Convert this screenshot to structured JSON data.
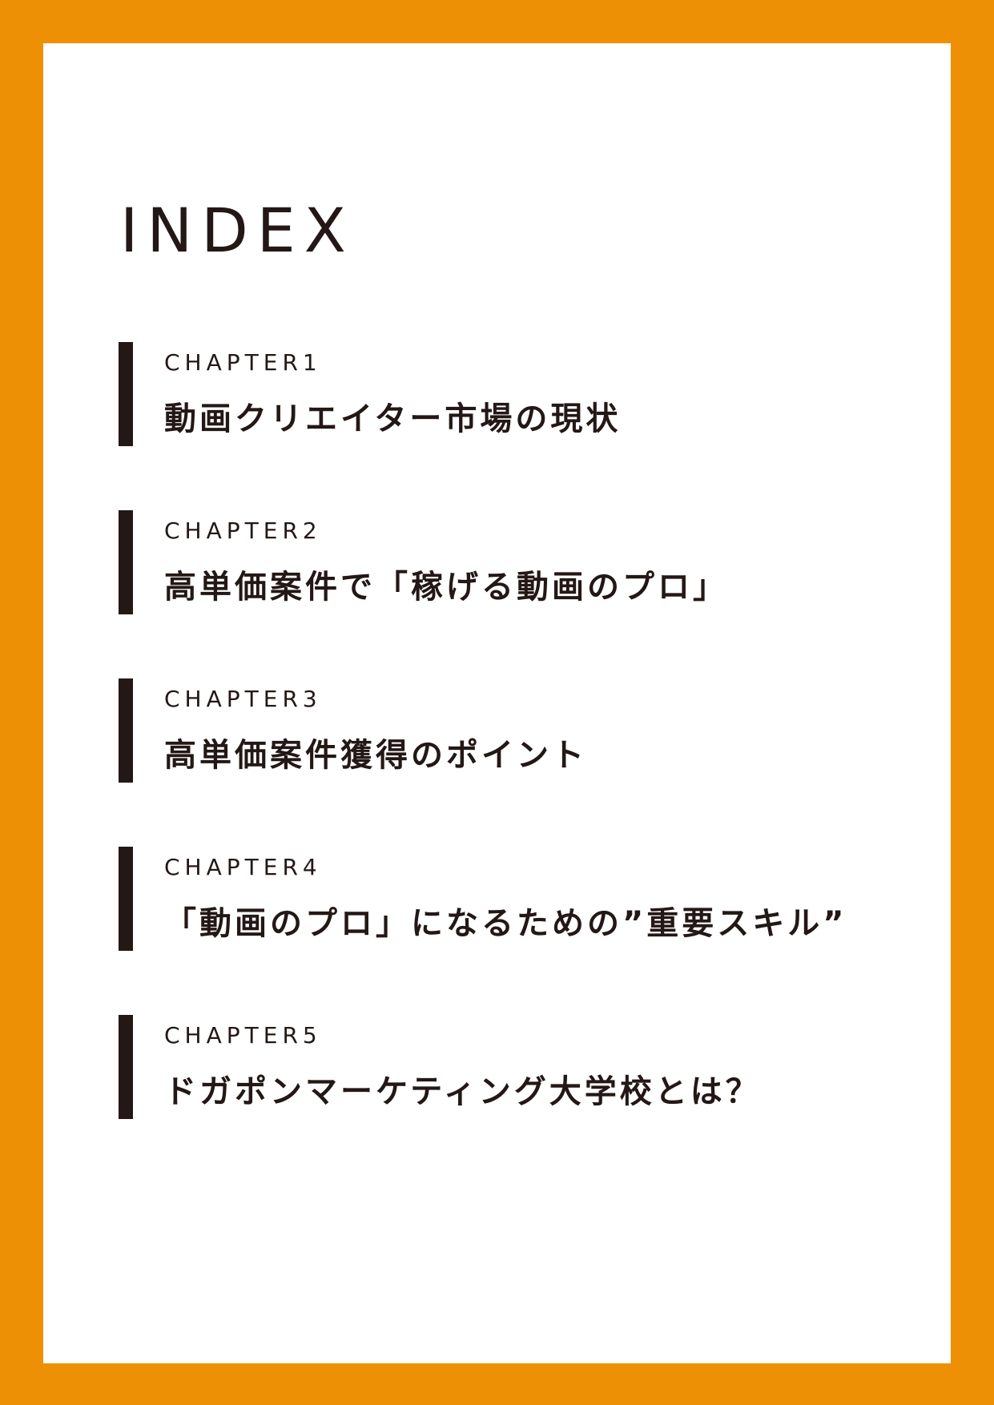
{
  "colors": {
    "frame": "#ED9005",
    "page": "#FFFFFF",
    "text": "#231815",
    "bar": "#231815"
  },
  "index_title": "INDEX",
  "chapters": [
    {
      "label": "CHAPTER1",
      "title": "動画クリエイター市場の現状"
    },
    {
      "label": "CHAPTER2",
      "title": "高単価案件で「稼げる動画のプロ」"
    },
    {
      "label": "CHAPTER3",
      "title": "高単価案件獲得のポイント"
    },
    {
      "label": "CHAPTER4",
      "title": "「動画のプロ」になるための”重要スキル”"
    },
    {
      "label": "CHAPTER5",
      "title": "ドガポンマーケティング大学校とは？"
    }
  ]
}
